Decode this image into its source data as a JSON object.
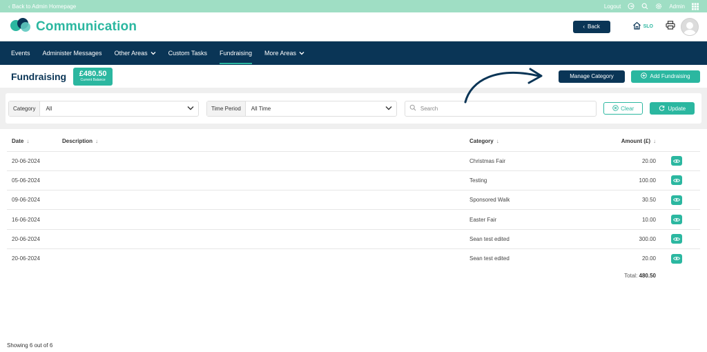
{
  "topbar": {
    "back_link": "Back to Admin Homepage",
    "logout": "Logout",
    "admin": "Admin"
  },
  "header": {
    "brand": "Communication",
    "back_button": "Back",
    "slo": "SLO"
  },
  "nav": {
    "items": [
      {
        "label": "Events"
      },
      {
        "label": "Administer Messages"
      },
      {
        "label": "Other Areas"
      },
      {
        "label": "Custom Tasks"
      },
      {
        "label": "Fundraising"
      },
      {
        "label": "More Areas"
      }
    ]
  },
  "page": {
    "title": "Fundraising",
    "balance_amount": "£480.50",
    "balance_label": "Current Balance",
    "manage_button": "Manage Category",
    "add_button": "Add Fundraising"
  },
  "filters": {
    "category_label": "Category",
    "category_value": "All",
    "period_label": "Time Period",
    "period_value": "All Time",
    "search_placeholder": "Search",
    "clear_button": "Clear",
    "update_button": "Update"
  },
  "table": {
    "headers": [
      "Date",
      "Description",
      "Category",
      "Amount (£)"
    ],
    "rows": [
      {
        "date": "20-06-2024",
        "description": "",
        "category": "Christmas Fair",
        "amount": "20.00"
      },
      {
        "date": "05-06-2024",
        "description": "",
        "category": "Testing",
        "amount": "100.00"
      },
      {
        "date": "09-06-2024",
        "description": "",
        "category": "Sponsored Walk",
        "amount": "30.50"
      },
      {
        "date": "16-06-2024",
        "description": "",
        "category": "Easter Fair",
        "amount": "10.00"
      },
      {
        "date": "20-06-2024",
        "description": "",
        "category": "Sean test edited",
        "amount": "300.00"
      },
      {
        "date": "20-06-2024",
        "description": "",
        "category": "Sean test edited",
        "amount": "20.00"
      }
    ],
    "total_label": "Total:",
    "total_value": "480.50"
  },
  "footer": {
    "showing": "Showing 6 out of 6"
  },
  "colors": {
    "navy": "#0a3556",
    "teal": "#2bb7a0",
    "topbar": "#9fdec4"
  }
}
